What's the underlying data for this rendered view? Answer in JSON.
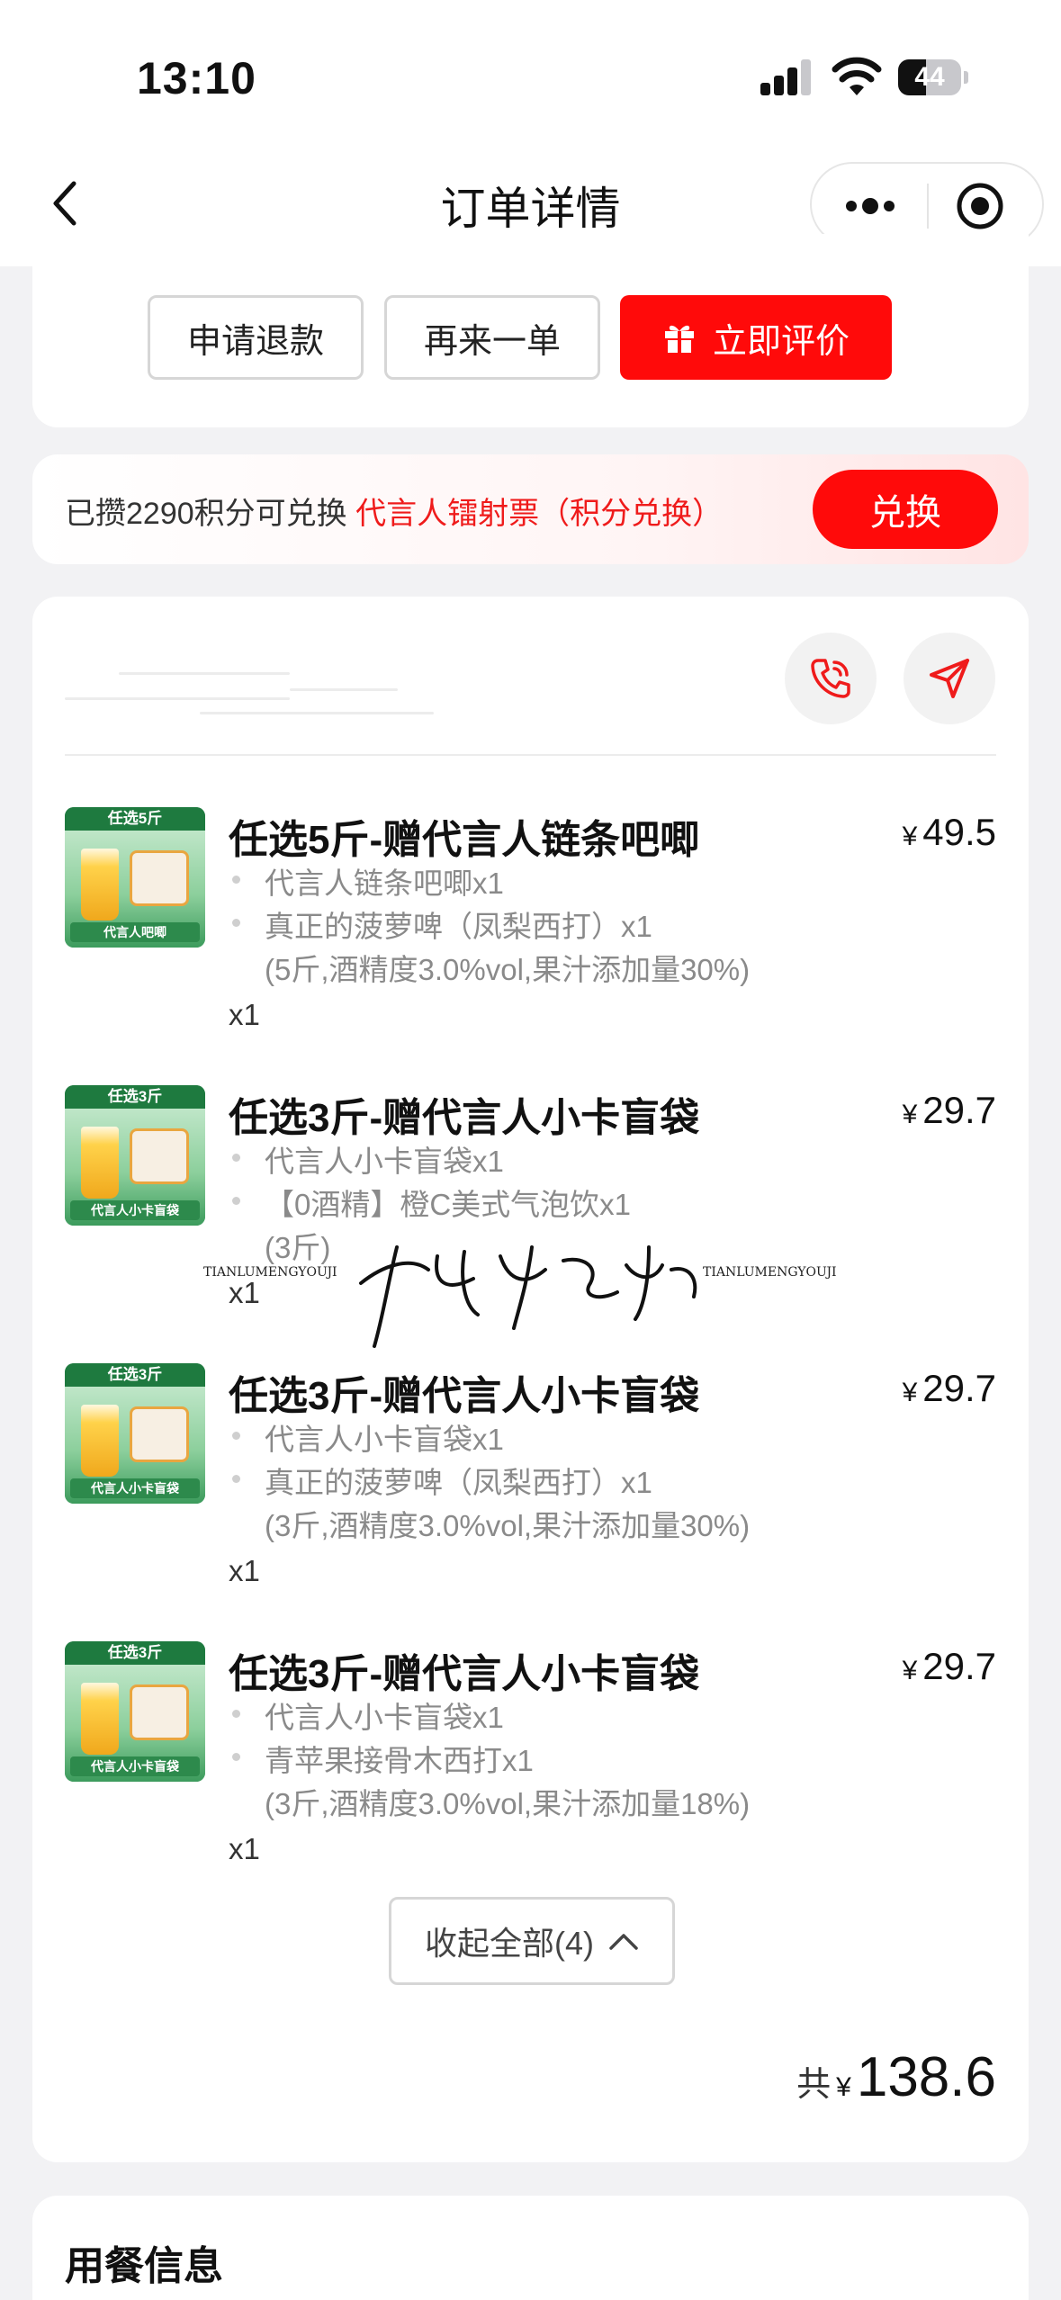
{
  "status_bar": {
    "time": "13:10",
    "battery": "44",
    "battery_level": 0.44
  },
  "nav": {
    "title": "订单详情"
  },
  "actions": {
    "refund": "申请退款",
    "reorder": "再来一单",
    "review": "立即评价"
  },
  "points_banner": {
    "prefix": "已攒2290积分可兑换 ",
    "highlight": "代言人镭射票（积分兑换）",
    "button": "兑换"
  },
  "order": {
    "items": [
      {
        "name": "任选5斤-赠代言人链条吧唧",
        "currency": "¥",
        "price": "49.5",
        "tag": "任选5斤",
        "band": "代言人吧唧",
        "subs": [
          "代言人链条吧唧x1",
          "真正的菠萝啤（凤梨西打）x1"
        ],
        "note": "(5斤,酒精度3.0%vol,果汁添加量30%)",
        "qty": "x1"
      },
      {
        "name": "任选3斤-赠代言人小卡盲袋",
        "currency": "¥",
        "price": "29.7",
        "tag": "任选3斤",
        "band": "代言人小卡盲袋",
        "subs": [
          "代言人小卡盲袋x1",
          "【0酒精】橙C美式气泡饮x1"
        ],
        "note": "(3斤)",
        "qty": "x1"
      },
      {
        "name": "任选3斤-赠代言人小卡盲袋",
        "currency": "¥",
        "price": "29.7",
        "tag": "任选3斤",
        "band": "代言人小卡盲袋",
        "subs": [
          "代言人小卡盲袋x1",
          "真正的菠萝啤（凤梨西打）x1"
        ],
        "note": "(3斤,酒精度3.0%vol,果汁添加量30%)",
        "qty": "x1"
      },
      {
        "name": "任选3斤-赠代言人小卡盲袋",
        "currency": "¥",
        "price": "29.7",
        "tag": "任选3斤",
        "band": "代言人小卡盲袋",
        "subs": [
          "代言人小卡盲袋x1",
          "青苹果接骨木西打x1"
        ],
        "note": "(3斤,酒精度3.0%vol,果汁添加量18%)",
        "qty": "x1"
      }
    ],
    "collapse_label": "收起全部(4)",
    "total_label": "共",
    "total_currency": "¥",
    "total_amount": "138.6"
  },
  "meal_section": {
    "title": "用餐信息"
  },
  "watermark": {
    "brand_left": "TIANLUMENGYOUJI",
    "brand_right": "TIANLUMENGYOUJI",
    "signature": "甜鹿梦游记"
  },
  "colors": {
    "accent": "#ff0a0a",
    "highlight_text": "#ef1b1b"
  }
}
